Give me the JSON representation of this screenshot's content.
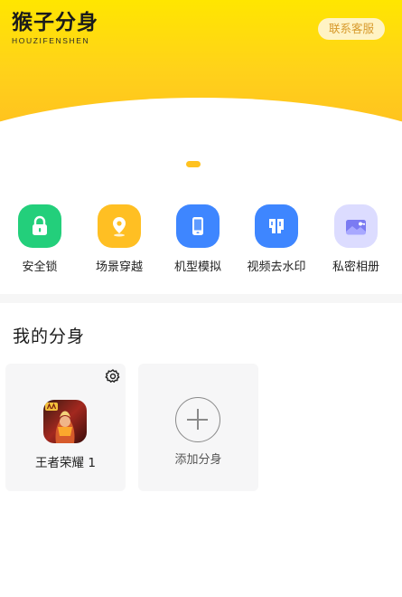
{
  "header": {
    "logo_title": "猴子分身",
    "logo_subtitle": "HOUZIFENSHEN",
    "contact_button": "联系客服"
  },
  "features": [
    {
      "label": "安全锁",
      "icon": "lock-icon",
      "color": "#23cf7b"
    },
    {
      "label": "场景穿越",
      "icon": "location-pin-icon",
      "color": "#ffbf23"
    },
    {
      "label": "机型模拟",
      "icon": "phone-icon",
      "color": "#3e86ff"
    },
    {
      "label": "视频去水印",
      "icon": "watermark-icon",
      "color": "#3e86ff"
    },
    {
      "label": "私密相册",
      "icon": "album-icon",
      "color": "#c9c8ff"
    }
  ],
  "section": {
    "title": "我的分身"
  },
  "clones": [
    {
      "label": "王者荣耀 1",
      "icon": "honor-of-kings-app-icon"
    }
  ],
  "add_card": {
    "label": "添加分身",
    "icon": "add-circle-icon"
  },
  "colors": {
    "brand_yellow": "#ffd21a",
    "contact_text": "#d79a2c",
    "card_bg": "#f6f6f7"
  }
}
